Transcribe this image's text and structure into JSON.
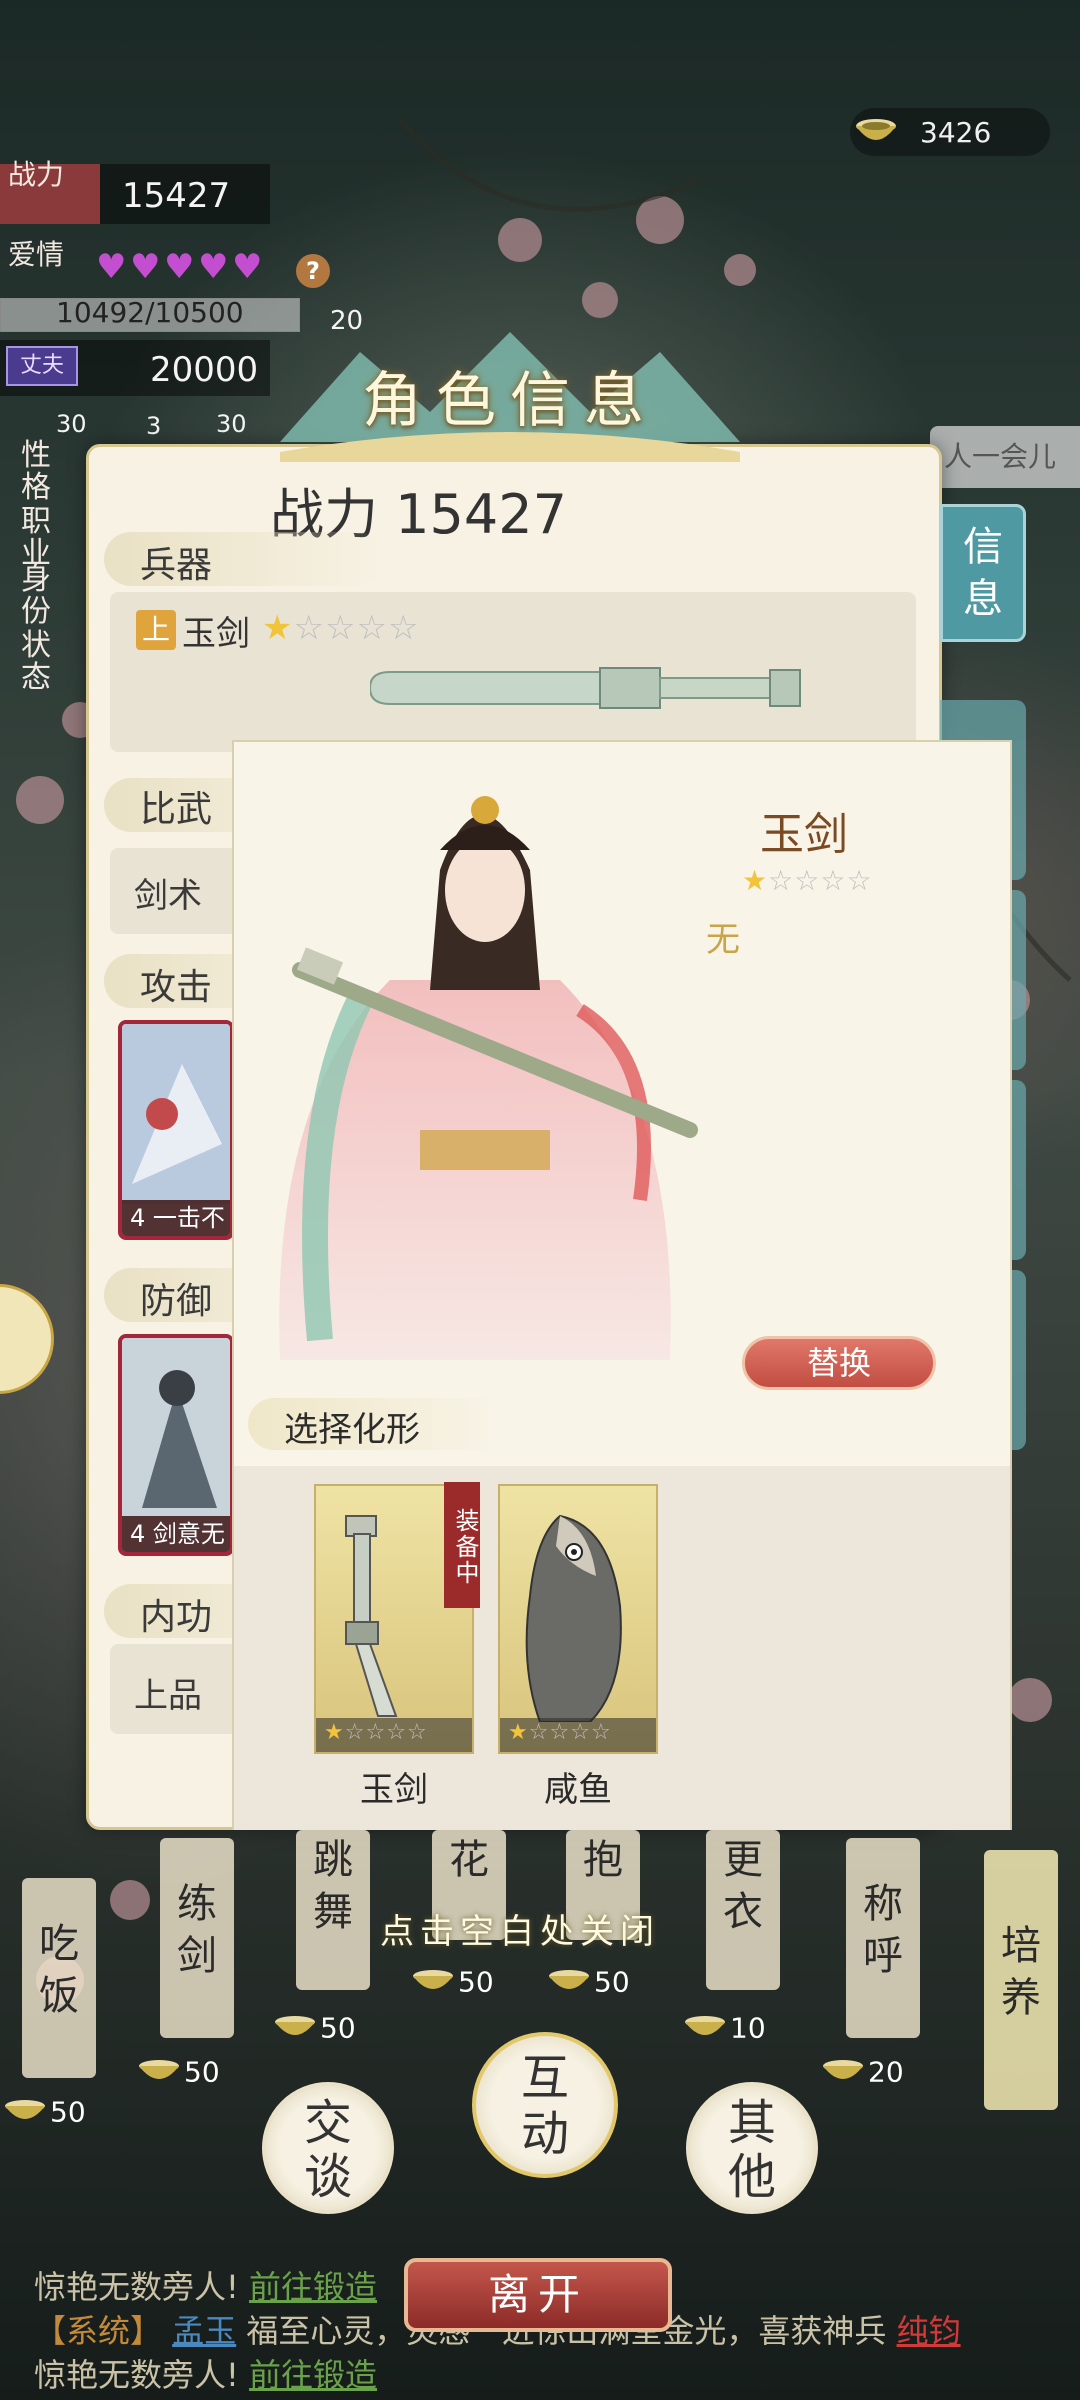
{
  "currency": {
    "amount": "3426",
    "icon": "tea-bowl-icon"
  },
  "stats": {
    "power_label": "战力",
    "power_value": "15427",
    "love_label": "爱情",
    "love_hearts": 5,
    "love_progress": "10492/10500",
    "love_extra": "20",
    "husband_badge": "丈夫",
    "husband_value": "20000",
    "small_counts": [
      "30",
      "3",
      "30"
    ],
    "traits": [
      "性格",
      "职业",
      "身份",
      "状态"
    ]
  },
  "panel": {
    "title": "角色信息",
    "power_text": "战力 15427",
    "weapon_section": "兵器",
    "weapon_grade": "上",
    "weapon_name": "玉剑",
    "weapon_stars": 1,
    "max_stars": 5,
    "martial_section": "比武",
    "martial_value": "剑术",
    "attack_section": "攻击",
    "attack_card": "4 一击不",
    "defense_section": "防御",
    "defense_card": "4 剑意无",
    "inner_section": "内功",
    "inner_value": "上品",
    "side_tab": "信息",
    "right_hint": "人一会儿"
  },
  "popup": {
    "weapon_title": "玉剑",
    "weapon_stars": 1,
    "effect": "无",
    "replace_button": "替换",
    "choose_title": "选择化形",
    "equipped_badge": "装备中",
    "skins": [
      {
        "name": "玉剑",
        "stars": 1,
        "icon": "jade-sword-icon"
      },
      {
        "name": "咸鱼",
        "stars": 1,
        "icon": "salted-fish-icon"
      }
    ]
  },
  "actions": {
    "close_tip": "点击空白处关闭",
    "items": [
      {
        "label": "吃饭",
        "cost": "50"
      },
      {
        "label": "练剑",
        "cost": "50"
      },
      {
        "label": "跳舞",
        "cost": "50"
      },
      {
        "label": "花",
        "cost": "50"
      },
      {
        "label": "抱",
        "cost": "50"
      },
      {
        "label": "更衣",
        "cost": "10"
      },
      {
        "label": "称呼",
        "cost": "20"
      },
      {
        "label": "培养",
        "cost": ""
      }
    ],
    "talk": "交谈",
    "interact": "互动",
    "other": "其他",
    "leave": "离开"
  },
  "chat": {
    "line1_text": "惊艳无数旁人!",
    "line1_link": "前往锻造",
    "line2_sys": "【系统】",
    "line2_name": "孟玉",
    "line2_text": "福至心灵，灵感一迸惊出满堂金光，喜获神兵",
    "line2_item": "纯钧",
    "line3_text": "惊艳无数旁人!",
    "line3_link": "前往锻造"
  }
}
